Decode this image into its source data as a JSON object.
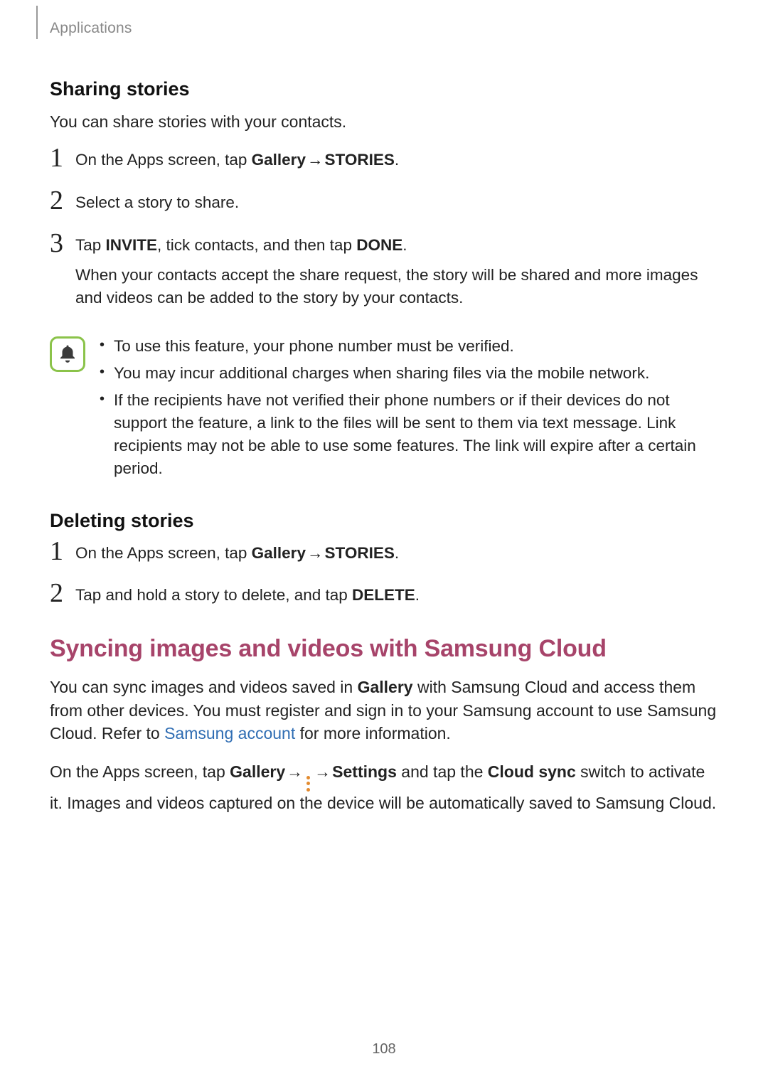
{
  "header": {
    "section": "Applications"
  },
  "sharing": {
    "heading": "Sharing stories",
    "intro": "You can share stories with your contacts.",
    "step1_pre": "On the Apps screen, tap ",
    "step1_gallery": "Gallery",
    "step1_arrow": " → ",
    "step1_stories": "STORIES",
    "step1_post": ".",
    "step2": "Select a story to share.",
    "step3_pre": "Tap ",
    "step3_invite": "INVITE",
    "step3_mid": ", tick contacts, and then tap ",
    "step3_done": "DONE",
    "step3_post": ".",
    "step3_para": "When your contacts accept the share request, the story will be shared and more images and videos can be added to the story by your contacts."
  },
  "notes": {
    "n1": "To use this feature, your phone number must be verified.",
    "n2": "You may incur additional charges when sharing files via the mobile network.",
    "n3": "If the recipients have not verified their phone numbers or if their devices do not support the feature, a link to the files will be sent to them via text message. Link recipients may not be able to use some features. The link will expire after a certain period."
  },
  "deleting": {
    "heading": "Deleting stories",
    "step1_pre": "On the Apps screen, tap ",
    "step1_gallery": "Gallery",
    "step1_arrow": " → ",
    "step1_stories": "STORIES",
    "step1_post": ".",
    "step2_pre": "Tap and hold a story to delete, and tap ",
    "step2_delete": "DELETE",
    "step2_post": "."
  },
  "sync": {
    "heading": "Syncing images and videos with Samsung Cloud",
    "p1_pre": "You can sync images and videos saved in ",
    "p1_gallery": "Gallery",
    "p1_mid": " with Samsung Cloud and access them from other devices. You must register and sign in to your Samsung account to use Samsung Cloud. Refer to ",
    "p1_link": "Samsung account",
    "p1_post": " for more information.",
    "p2_pre": "On the Apps screen, tap ",
    "p2_gallery": "Gallery",
    "p2_arrow1": " → ",
    "p2_arrow2": " → ",
    "p2_settings": "Settings",
    "p2_mid": " and tap the ",
    "p2_cloud": "Cloud sync",
    "p2_post": " switch to activate it. Images and videos captured on the device will be automatically saved to Samsung Cloud."
  },
  "pageNumber": "108"
}
